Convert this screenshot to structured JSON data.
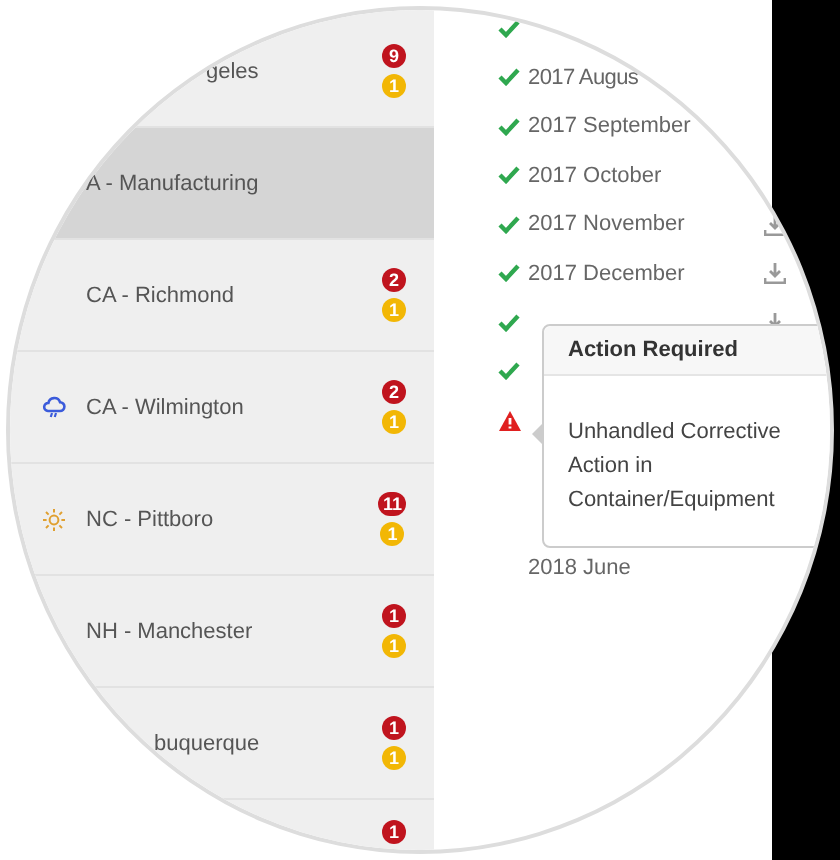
{
  "sidebar": {
    "items": [
      {
        "label": "geles",
        "kind": "plain",
        "selected": false,
        "red_count": "9",
        "yellow_count": "1"
      },
      {
        "label": "A - Manufacturing",
        "kind": "plain",
        "selected": true
      },
      {
        "label": "CA - Richmond",
        "kind": "plain",
        "selected": false,
        "red_count": "2",
        "yellow_count": "1"
      },
      {
        "label": "CA - Wilmington",
        "kind": "rain",
        "selected": false,
        "red_count": "2",
        "yellow_count": "1"
      },
      {
        "label": "NC - Pittboro",
        "kind": "sun",
        "selected": false,
        "red_count": "11",
        "yellow_count": "1"
      },
      {
        "label": "NH - Manchester",
        "kind": "plain",
        "selected": false,
        "red_count": "1",
        "yellow_count": "1"
      },
      {
        "label": "buquerque",
        "kind": "plain",
        "selected": false,
        "red_count": "1",
        "yellow_count": "1"
      },
      {
        "kind": "plain",
        "selected": false,
        "red_count": "1"
      }
    ]
  },
  "months": [
    {
      "kind": "done",
      "download": false
    },
    {
      "label": "2017 Augus",
      "kind": "done",
      "download": false
    },
    {
      "label": "2017 September",
      "kind": "done",
      "download": false
    },
    {
      "label": "2017 October",
      "kind": "done",
      "download": false
    },
    {
      "label": "2017 November",
      "kind": "done",
      "download": true
    },
    {
      "label": "2017 December",
      "kind": "done",
      "download": true
    },
    {
      "kind": "done",
      "download": true
    },
    {
      "kind": "done",
      "download": false
    },
    {
      "kind": "warning",
      "download": false
    },
    {
      "kind": "plain",
      "download": false
    },
    {
      "kind": "plain",
      "download": false
    },
    {
      "label": "2018 June",
      "kind": "plain",
      "download": false
    }
  ],
  "popover": {
    "title": "Action Required",
    "text": "Unhandled Corrective Action in Container/Equipment"
  }
}
